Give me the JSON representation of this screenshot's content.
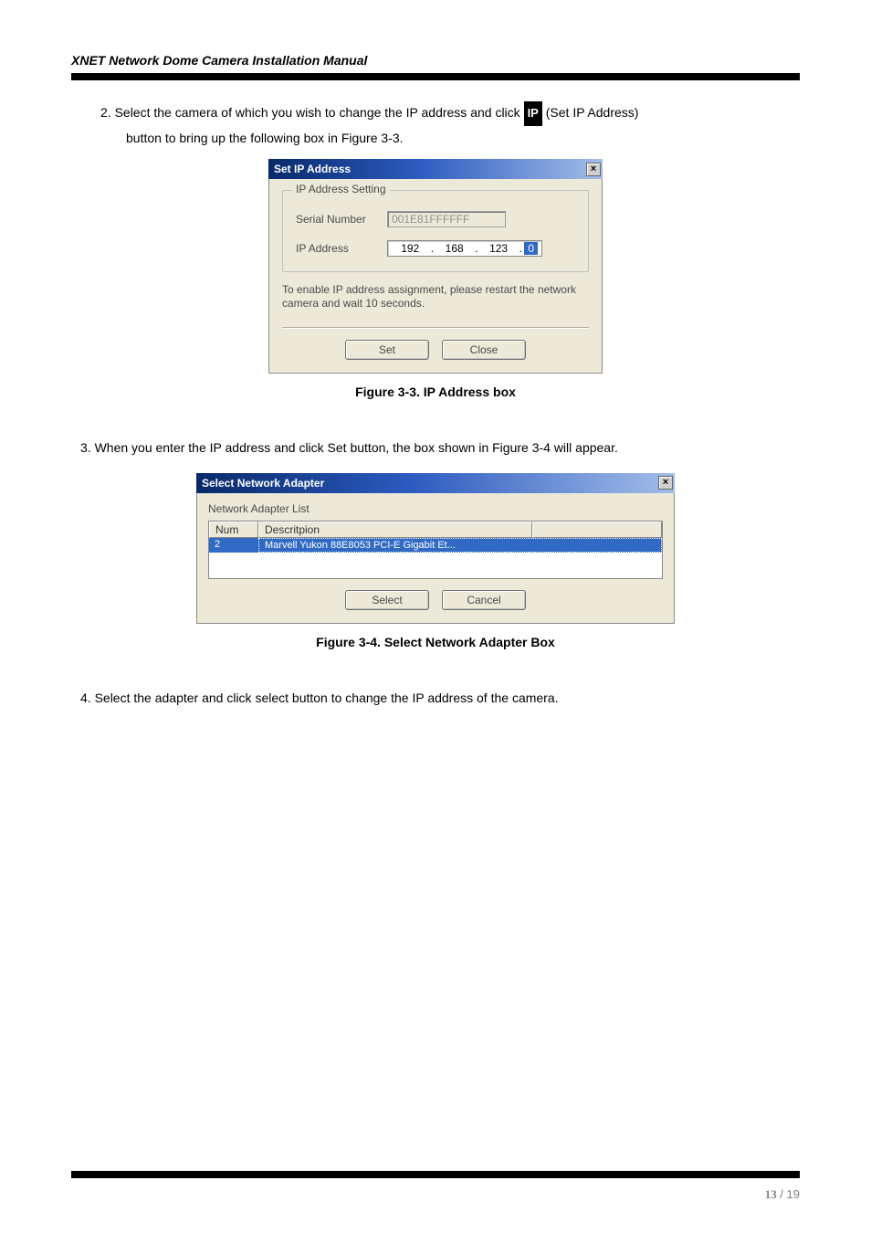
{
  "header": {
    "doc_title": "XNET Network Dome Camera Installation Manual"
  },
  "step2": {
    "line1_a": "2. Select the camera of which you wish to change the IP address and click ",
    "ip_icon_text": "IP",
    "line1_b": "(Set IP Address)",
    "line2": "button to bring up the following box in Figure 3-3."
  },
  "dialog1": {
    "title": "Set IP Address",
    "group_legend": "IP Address Setting",
    "serial_label": "Serial Number",
    "serial_value": "001E81FFFFFF",
    "ip_label": "IP Address",
    "ip_seg1": "192",
    "ip_seg2": "168",
    "ip_seg3": "123",
    "ip_seg4": "0",
    "hint": "To enable IP address assignment, please restart the network camera and wait 10 seconds.",
    "set_btn": "Set",
    "close_btn": "Close"
  },
  "caption1": "Figure 3-3. IP Address box",
  "step3": {
    "text": "3. When you enter the IP address and click Set button, the box shown in Figure 3-4 will appear."
  },
  "dialog2": {
    "title": "Select Network Adapter",
    "list_label": "Network Adapter List",
    "col_num": "Num",
    "col_desc": "Descritpion",
    "row_num": "2",
    "row_desc": "Marvell Yukon 88E8053 PCI-E Gigabit Et...",
    "select_btn": "Select",
    "cancel_btn": "Cancel"
  },
  "caption2": "Figure 3-4. Select Network Adapter Box",
  "step4": {
    "text": "4. Select the adapter and click select button to change the IP address of the camera."
  },
  "footer": {
    "current": "13",
    "sep": " / ",
    "total": "19"
  }
}
